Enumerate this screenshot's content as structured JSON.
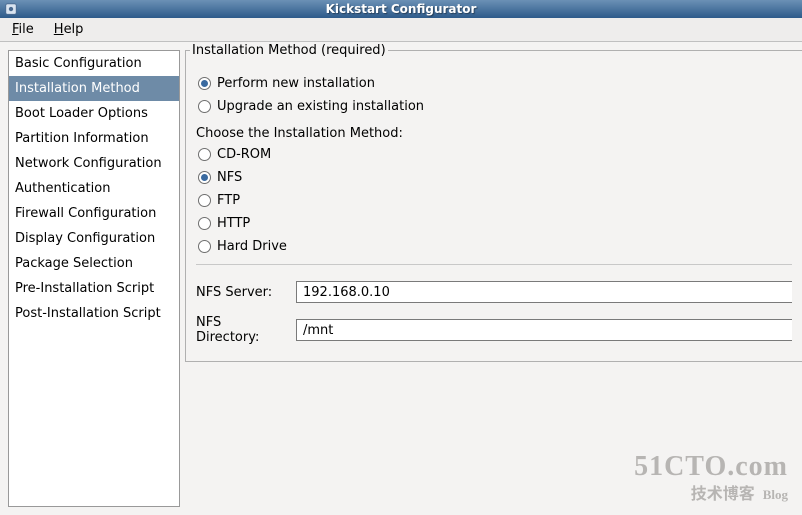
{
  "title": "Kickstart Configurator",
  "menus": {
    "file": "File",
    "help": "Help"
  },
  "sidebar": {
    "items": [
      {
        "label": "Basic Configuration"
      },
      {
        "label": "Installation Method"
      },
      {
        "label": "Boot Loader Options"
      },
      {
        "label": "Partition Information"
      },
      {
        "label": "Network Configuration"
      },
      {
        "label": "Authentication"
      },
      {
        "label": "Firewall Configuration"
      },
      {
        "label": "Display Configuration"
      },
      {
        "label": "Package Selection"
      },
      {
        "label": "Pre-Installation Script"
      },
      {
        "label": "Post-Installation Script"
      }
    ],
    "selected_index": 1
  },
  "main": {
    "group_title": "Installation Method (required)",
    "install_type": {
      "options": [
        {
          "label": "Perform new installation"
        },
        {
          "label": "Upgrade an existing installation"
        }
      ],
      "selected_index": 0
    },
    "choose_label": "Choose the Installation Method:",
    "method": {
      "options": [
        {
          "label": "CD-ROM"
        },
        {
          "label": "NFS"
        },
        {
          "label": "FTP"
        },
        {
          "label": "HTTP"
        },
        {
          "label": "Hard Drive"
        }
      ],
      "selected_index": 1
    },
    "nfs": {
      "server_label": "NFS Server:",
      "server_value": "192.168.0.10",
      "directory_label": "NFS Directory:",
      "directory_value": "/mnt"
    }
  },
  "watermark": {
    "line1": "51CTO.com",
    "line2a": "技术博客",
    "line2b": "Blog"
  }
}
